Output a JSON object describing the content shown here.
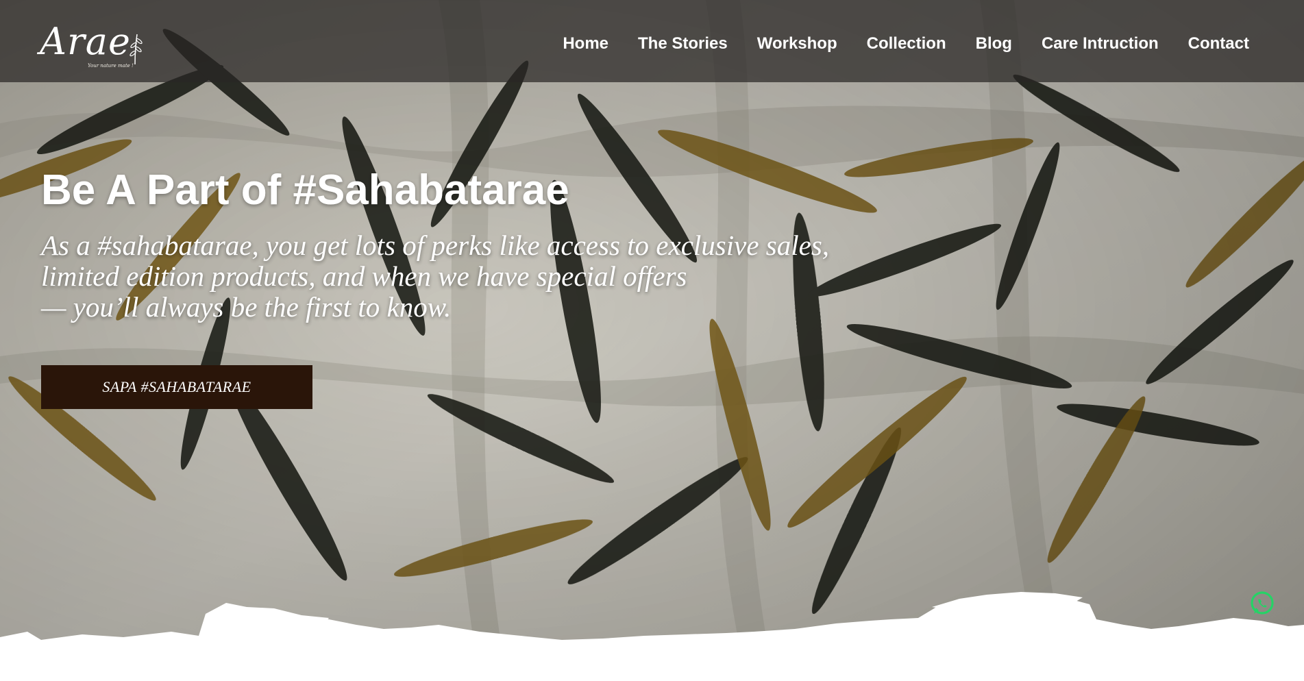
{
  "brand": {
    "logo_text": "Arae",
    "logo_tagline": "Your nature mate !"
  },
  "nav": {
    "items": [
      {
        "label": "Home"
      },
      {
        "label": "The Stories"
      },
      {
        "label": "Workshop"
      },
      {
        "label": "Collection"
      },
      {
        "label": "Blog"
      },
      {
        "label": "Care Intruction"
      },
      {
        "label": "Contact"
      }
    ]
  },
  "hero": {
    "title": "Be A Part of #Sahabatarae",
    "subtitle_lines": [
      "As a #sahabatarae, you get lots of perks like access to exclusive sales,",
      "limited edition products, and when we have special offers",
      "— you’ll always be the first to know."
    ],
    "cta_label": "SAPA #SAHABATARAE"
  },
  "floating": {
    "whatsapp_icon": "whatsapp-icon"
  },
  "colors": {
    "header_bg": "#282624",
    "cta_bg": "#2a1509",
    "whatsapp_green": "#25d366",
    "leaf_dark": "#23251d",
    "leaf_ochre": "#8a6a1c"
  }
}
